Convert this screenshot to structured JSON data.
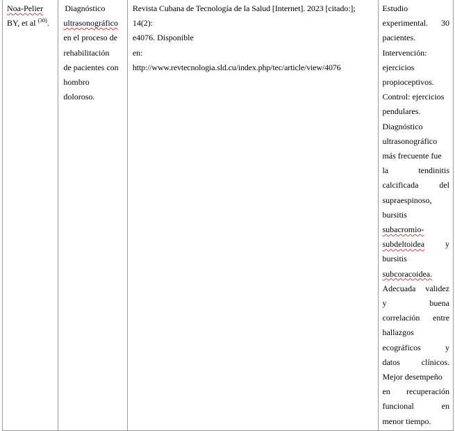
{
  "row": {
    "author": {
      "name_part1": "Noa-Pelier",
      "name_part2": "BY, et al",
      "ref": "(30)",
      "punct": "."
    },
    "title": {
      "word1": "Diagnóstico",
      "word2": "ultrasonográfico",
      "line3": "en el proceso de",
      "line4": "rehabilitación",
      "line5": "de pacientes con",
      "line6": "hombro",
      "line7": "doloroso."
    },
    "citation": {
      "line1": "Revista Cubana de Tecnología de la Salud [Internet]. 2023 [citado:];",
      "line2": "14(2):",
      "line3": "e4076. Disponible",
      "line4": "en:",
      "line5": "http://www.revtecnologia.sld.cu/index.php/tec/article/view/4076"
    },
    "summary": {
      "l01": "Estudio",
      "l02a": "experimental.",
      "l02b": "30",
      "l03": "pacientes.",
      "l04": "Intervención:",
      "l05": "ejercicios",
      "l06": "propioceptivos.",
      "l07": "Control: ejercicios",
      "l08": "pendulares.",
      "l09": "Diagnóstico",
      "l10": "ultrasonográfico",
      "l11": "más frecuente fue",
      "l12a": "la",
      "l12b": "tendinitis",
      "l13a": "calcificada",
      "l13b": "del",
      "l14": "supraespinoso,",
      "l15": "bursitis",
      "l16": "subacromio-",
      "l17a": "subdeltoidea",
      "l17b": "y",
      "l18": "bursitis",
      "l19": "subcoracoidea.",
      "l20a": "Adecuada",
      "l20b": "validez",
      "l21a": "y",
      "l21b": "buena",
      "l22a": "correlación",
      "l22b": "entre",
      "l23": "hallazgos",
      "l24a": "ecográficos",
      "l24b": "y",
      "l25a": "datos",
      "l25b": "clínicos.",
      "l26": "Mejor desempeño",
      "l27a": "en",
      "l27b": "recuperación",
      "l28a": "funcional",
      "l28b": "en",
      "l29": "menor tiempo."
    }
  }
}
